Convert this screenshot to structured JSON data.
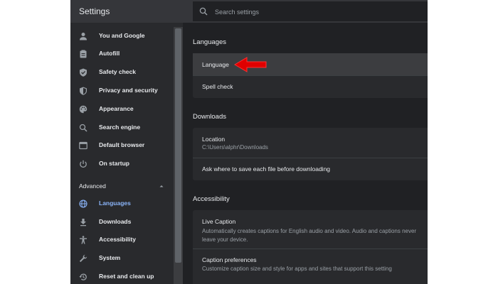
{
  "app": {
    "title": "Settings"
  },
  "search": {
    "placeholder": "Search settings"
  },
  "sidebar": {
    "items": [
      {
        "label": "You and Google",
        "icon": "person-icon"
      },
      {
        "label": "Autofill",
        "icon": "clipboard-icon"
      },
      {
        "label": "Safety check",
        "icon": "shield-check-icon"
      },
      {
        "label": "Privacy and security",
        "icon": "shield-lock-icon"
      },
      {
        "label": "Appearance",
        "icon": "palette-icon"
      },
      {
        "label": "Search engine",
        "icon": "search-icon"
      },
      {
        "label": "Default browser",
        "icon": "browser-window-icon"
      },
      {
        "label": "On startup",
        "icon": "power-icon"
      }
    ],
    "advanced_label": "Advanced",
    "advanced_items": [
      {
        "label": "Languages",
        "icon": "globe-icon",
        "active": true
      },
      {
        "label": "Downloads",
        "icon": "download-icon"
      },
      {
        "label": "Accessibility",
        "icon": "accessibility-icon"
      },
      {
        "label": "System",
        "icon": "wrench-icon"
      },
      {
        "label": "Reset and clean up",
        "icon": "restore-icon"
      }
    ]
  },
  "main": {
    "languages": {
      "title": "Languages",
      "rows": [
        {
          "label": "Language"
        },
        {
          "label": "Spell check"
        }
      ]
    },
    "downloads": {
      "title": "Downloads",
      "location_label": "Location",
      "location_value": "C:\\Users\\alphr\\Downloads",
      "ask_label": "Ask where to save each file before downloading"
    },
    "accessibility": {
      "title": "Accessibility",
      "live_caption_label": "Live Caption",
      "live_caption_desc": "Automatically creates captions for English audio and video. Audio and captions never leave your device.",
      "caption_prefs_label": "Caption preferences",
      "caption_prefs_desc": "Customize caption size and style for apps and sites that support this setting"
    }
  },
  "colors": {
    "accent": "#8ab4f8",
    "annotation_arrow": "#e00000",
    "background": "#202124",
    "sidebar": "#292a2d"
  }
}
